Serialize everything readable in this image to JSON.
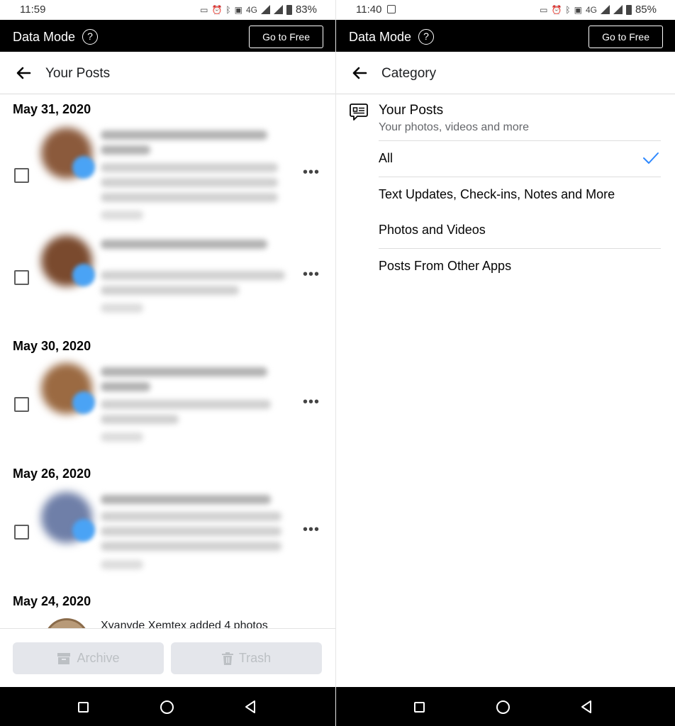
{
  "left": {
    "status": {
      "time": "11:59",
      "battery": "83%",
      "network": "4G"
    },
    "data_mode": {
      "label": "Data Mode",
      "help": "?",
      "go_free": "Go to Free"
    },
    "header": {
      "title": "Your Posts"
    },
    "dates": [
      "May 31, 2020",
      "May 30, 2020",
      "May 26, 2020",
      "May 24, 2020"
    ],
    "last_post_text": "Xyanyde Xemtex added 4 photos",
    "actions": {
      "archive": "Archive",
      "trash": "Trash"
    }
  },
  "right": {
    "status": {
      "time": "11:40",
      "battery": "85%",
      "network": "4G"
    },
    "data_mode": {
      "label": "Data Mode",
      "help": "?",
      "go_free": "Go to Free"
    },
    "header": {
      "title": "Category"
    },
    "category": {
      "title": "Your Posts",
      "subtitle": "Your photos, videos and more"
    },
    "options": [
      {
        "label": "All",
        "selected": true
      },
      {
        "label": "Text Updates, Check-ins, Notes and More",
        "selected": false
      },
      {
        "label": "Photos and Videos",
        "selected": false
      },
      {
        "label": "Posts From Other Apps",
        "selected": false
      }
    ]
  },
  "colors": {
    "accent": "#1877f2",
    "check": "#2d88ff",
    "disabled_bg": "#e4e6eb",
    "disabled_text": "#bcc0c4",
    "data_bar": "#000000"
  }
}
